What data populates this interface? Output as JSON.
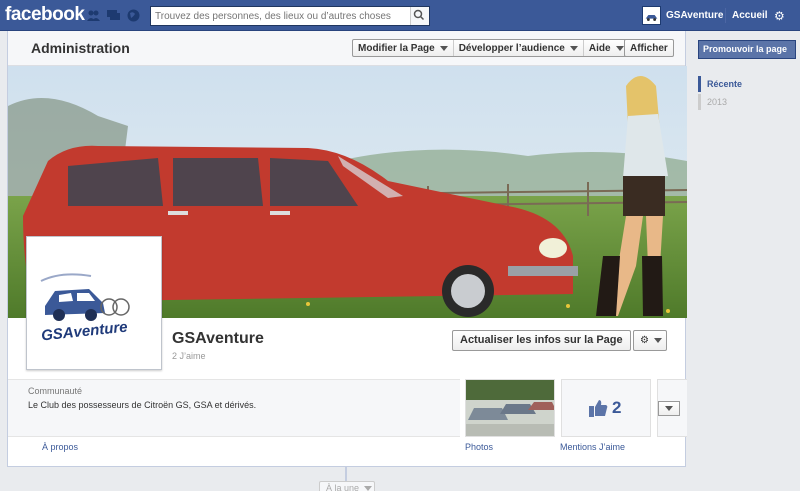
{
  "topbar": {
    "logo": "facebook",
    "search_placeholder": "Trouvez des personnes, des lieux ou d’autres choses",
    "account_name": "GSAventure",
    "home_label": "Accueil"
  },
  "admin": {
    "title": "Administration",
    "menu": [
      "Modifier la Page",
      "Développer l’audience",
      "Aide"
    ],
    "view_label": "Afficher"
  },
  "page": {
    "name": "GSAventure",
    "likes_sub": "2 J’aime",
    "update_label": "Actualiser les infos sur la Page",
    "logo_text": "GSAventure",
    "category": "Communauté",
    "description": "Le Club des possesseurs de Citroën GS, GSA et dérivés.",
    "likes_count": "2"
  },
  "tabs": {
    "about": "À propos",
    "photos": "Photos",
    "likes": "Mentions J’aime"
  },
  "rail": {
    "promote": "Promouvoir la page",
    "recent": "Récente",
    "year": "2013"
  },
  "timeline": {
    "top_button": "À la une"
  },
  "colors": {
    "brand": "#3b5998",
    "car": "#c23a2e"
  }
}
